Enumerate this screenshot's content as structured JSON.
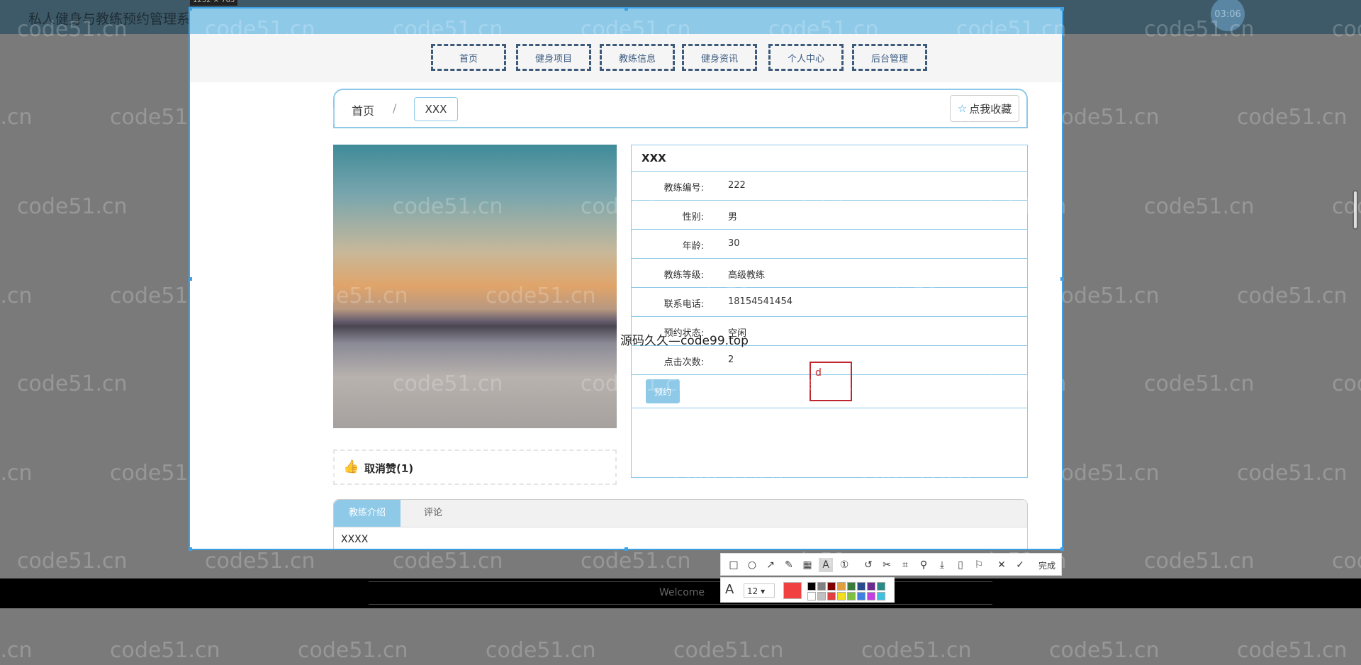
{
  "app": {
    "title": "私人健身与教练预约管理系统",
    "clock": "03:06",
    "capture_size": "1232 × 763",
    "footer_text": "Welcome"
  },
  "nav": {
    "items": [
      "首页",
      "健身项目",
      "教练信息",
      "健身资讯",
      "个人中心",
      "后台管理"
    ]
  },
  "breadcrumb": {
    "home": "首页",
    "sep": "/",
    "current": "XXX"
  },
  "favorite_button": "点我收藏",
  "like": {
    "label": "取消赞(1)"
  },
  "coach": {
    "name": "XXX",
    "fields": [
      {
        "label": "教练编号:",
        "value": "222"
      },
      {
        "label": "性别:",
        "value": "男"
      },
      {
        "label": "年龄:",
        "value": "30"
      },
      {
        "label": "教练等级:",
        "value": "高级教练"
      },
      {
        "label": "联系电话:",
        "value": "18154541454"
      },
      {
        "label": "预约状态:",
        "value": "空闲"
      },
      {
        "label": "点击次数:",
        "value": "2"
      }
    ],
    "book_button": "预约"
  },
  "overlay_text": "源码久久—code99.top",
  "edit_text": "d",
  "tabs": {
    "items": [
      "教练介绍",
      "评论"
    ],
    "content": "XXXX"
  },
  "toolbar": {
    "done_label": "完成",
    "font_size": "12",
    "current_color": "#f04040",
    "swatches": [
      "#000000",
      "#808080",
      "#800000",
      "#e0a040",
      "#3a7a3a",
      "#2a4a90",
      "#6a2a90",
      "#2a8a8a",
      "#ffffff",
      "#c0c0c0",
      "#e04040",
      "#f0e020",
      "#80c040",
      "#4080e0",
      "#c040e0",
      "#40c0e0"
    ],
    "icons": [
      "rect-icon",
      "ellipse-icon",
      "arrow-icon",
      "pen-icon",
      "mosaic-icon",
      "text-icon",
      "number-icon",
      "undo-icon",
      "cut-icon",
      "ocr-icon",
      "pin-icon",
      "download-icon",
      "copy-icon",
      "bookmark-icon",
      "close-icon",
      "check-icon"
    ]
  },
  "watermark": "code51.cn"
}
